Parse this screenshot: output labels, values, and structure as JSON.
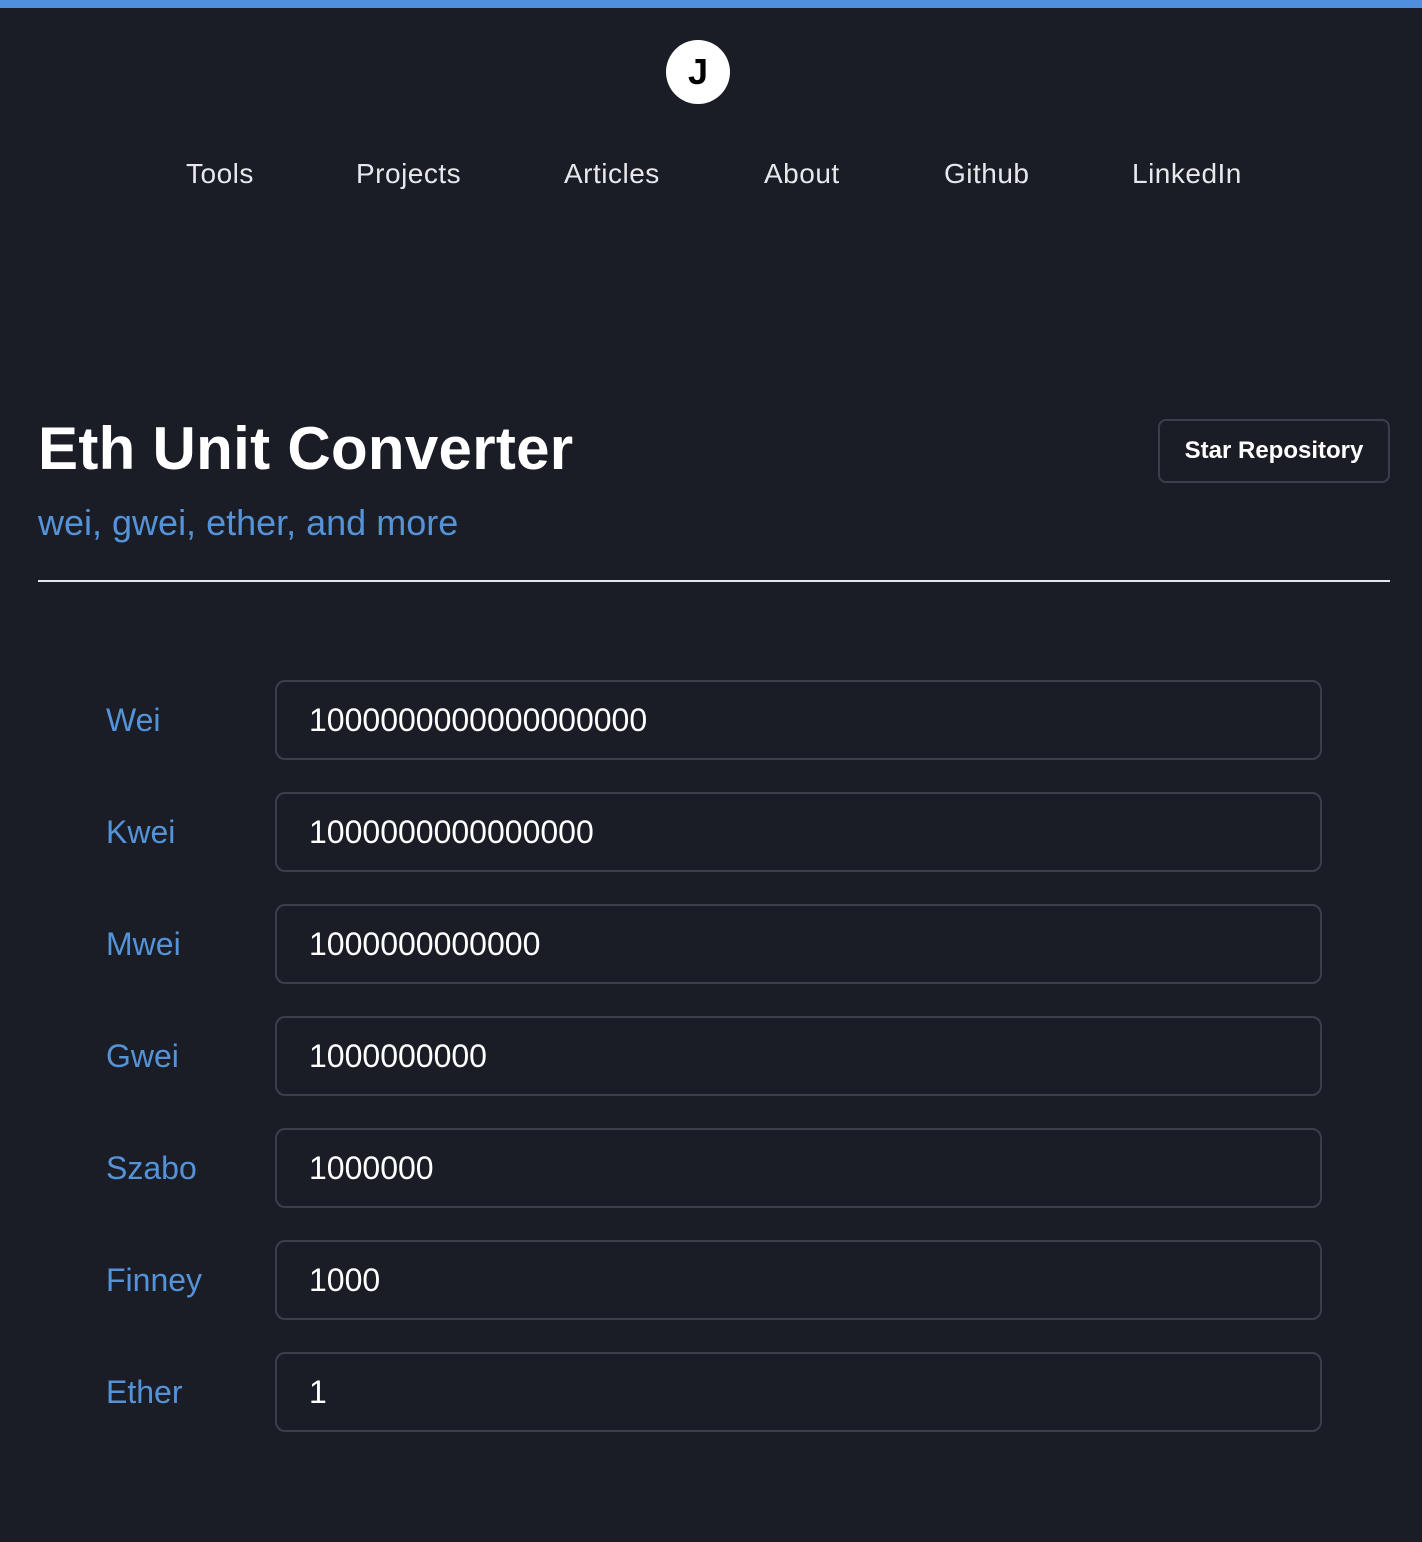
{
  "site": {
    "logo_letter": "J",
    "accent_color": "#4f8fdc"
  },
  "nav": {
    "items": [
      {
        "label": "Tools"
      },
      {
        "label": "Projects"
      },
      {
        "label": "Articles"
      },
      {
        "label": "About"
      },
      {
        "label": "Github"
      },
      {
        "label": "LinkedIn"
      }
    ]
  },
  "header": {
    "title": "Eth Unit Converter",
    "subtitle": "wei, gwei, ether, and more",
    "star_button_label": "Star Repository"
  },
  "converter": {
    "rows": [
      {
        "label": "Wei",
        "value": "1000000000000000000"
      },
      {
        "label": "Kwei",
        "value": "1000000000000000"
      },
      {
        "label": "Mwei",
        "value": "1000000000000"
      },
      {
        "label": "Gwei",
        "value": "1000000000"
      },
      {
        "label": "Szabo",
        "value": "1000000"
      },
      {
        "label": "Finney",
        "value": "1000"
      },
      {
        "label": "Ether",
        "value": "1"
      }
    ]
  },
  "colors": {
    "background": "#1a1d26",
    "label_blue": "#5593d8",
    "border": "#3b3f4a"
  }
}
